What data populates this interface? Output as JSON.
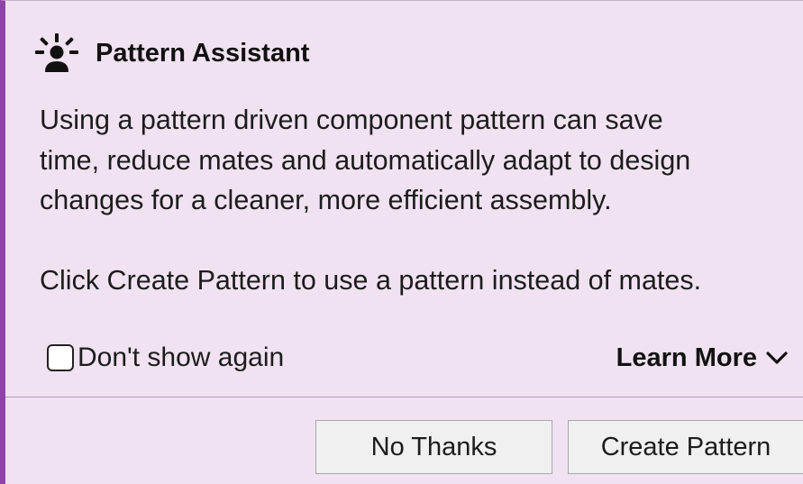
{
  "assistant": {
    "title": "Pattern Assistant",
    "icon": "lightbulb-person-icon",
    "message_lines": [
      "Using a pattern driven component pattern can save",
      "time, reduce mates and automatically adapt to design",
      "changes for a cleaner, more efficient assembly."
    ],
    "instruction": "Click Create Pattern to use a pattern instead of mates.",
    "dont_show_label": "Don't show again",
    "dont_show_checked": false,
    "learn_more_label": "Learn More",
    "no_thanks_label": "No Thanks",
    "create_pattern_label": "Create Pattern"
  },
  "colors": {
    "background": "#f1e2f2",
    "accent_border": "#8e44a6",
    "button_background": "#f0f0f0"
  }
}
